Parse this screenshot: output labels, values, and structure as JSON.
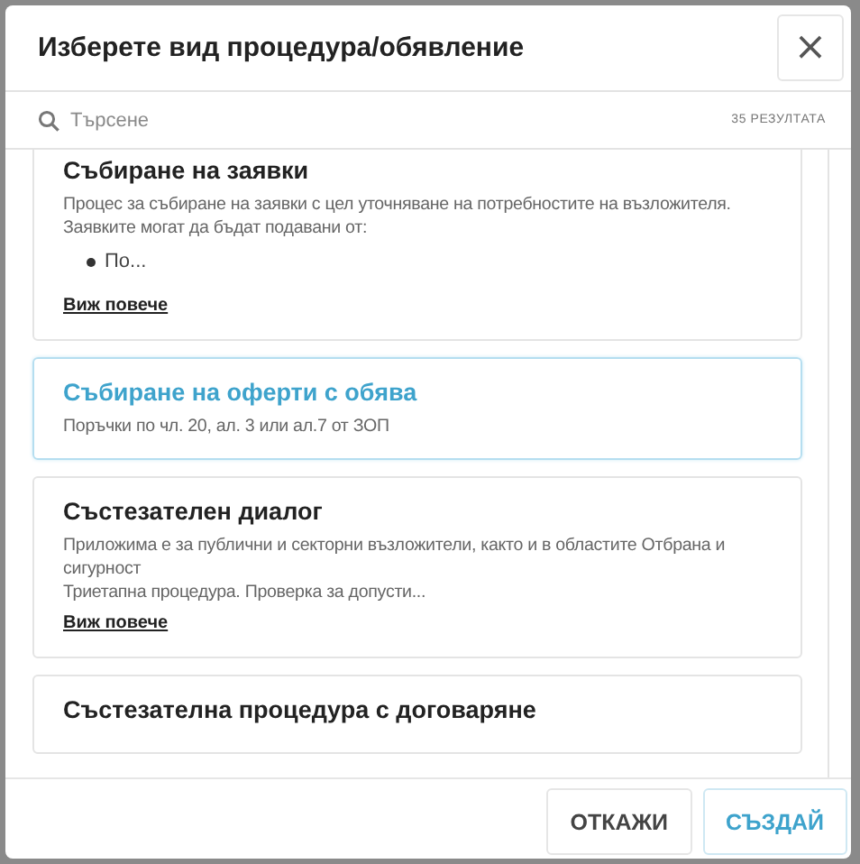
{
  "dialog": {
    "title": "Изберете вид процедура/обявление",
    "close": "×"
  },
  "search": {
    "placeholder": "Търсене",
    "results": "35 РЕЗУЛТАТА"
  },
  "procedures": [
    {
      "title": "Събиране на заявки",
      "selected": false,
      "paragraphs": [
        "Процес за събиране на заявки с цел уточняване на потребностите на възложителя.",
        "Заявките могат да бъдат подавани от:"
      ],
      "bullets": [
        "По..."
      ],
      "more_link": "Виж повече"
    },
    {
      "title": "Събиране на оферти с обява",
      "selected": true,
      "paragraphs": [
        "Поръчки по чл. 20, ал. 3 или ал.7 от ЗОП"
      ]
    },
    {
      "title": "Състезателен диалог",
      "selected": false,
      "paragraphs": [
        "Приложима е за публични и секторни възложители, както и в областите Отбрана и сигурност",
        "Триетапна процедура. Проверка за допусти..."
      ],
      "more_link": "Виж повече"
    },
    {
      "title": "Състезателна процедура с договаряне",
      "selected": false
    }
  ],
  "buttons": [
    {
      "label": "ОТКАЖИ",
      "kind": "secondary"
    },
    {
      "label": "СЪЗДАЙ",
      "kind": "primary"
    }
  ]
}
